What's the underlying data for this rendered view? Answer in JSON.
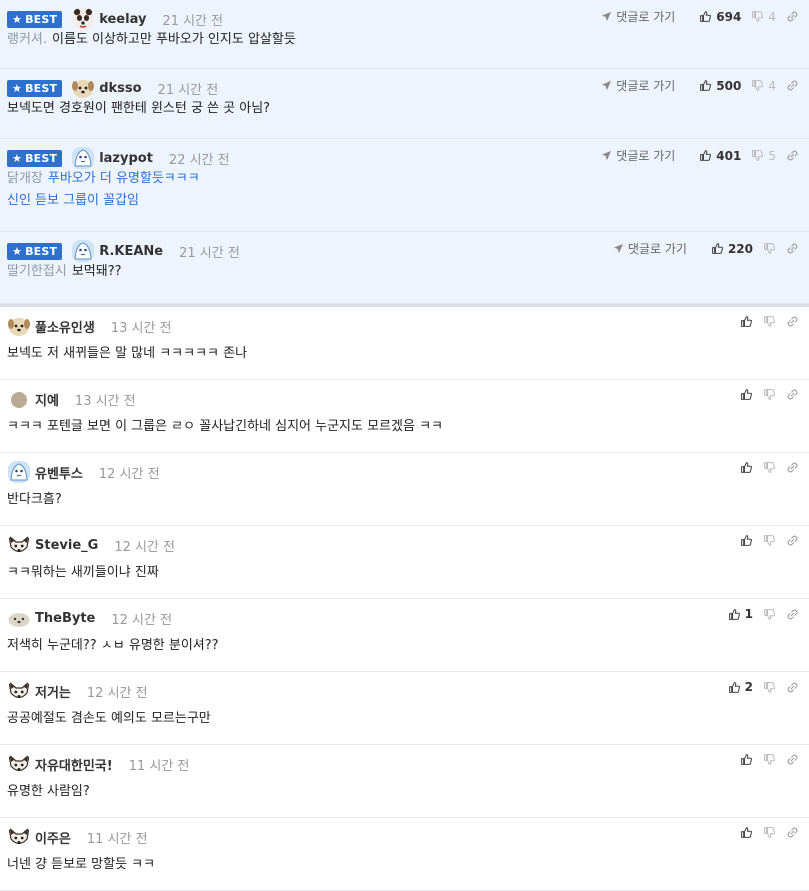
{
  "labels": {
    "best": "BEST",
    "goto": "댓글로 가기"
  },
  "best_comments": [
    {
      "nick": "keelay",
      "time": "21 시간 전",
      "lines": [
        {
          "prefix": "랭커셔.",
          "text": "이름도 이상하고만 푸바오가 인지도 압살할듯"
        }
      ],
      "up": "694",
      "down": "4",
      "avatar": "panda"
    },
    {
      "nick": "dksso",
      "time": "21 시간 전",
      "lines": [
        {
          "prefix": "",
          "text": "보넥도면 경호원이 팬한테 윈스턴 궁 쓴 곳 아님?"
        }
      ],
      "up": "500",
      "down": "4",
      "avatar": "dog"
    },
    {
      "nick": "lazypot",
      "time": "22 시간 전",
      "lines": [
        {
          "prefix": "닭개장",
          "text": "푸바오가 더 유명할듯ㅋㅋㅋ"
        },
        {
          "prefix": "",
          "text": "신인 듣보 그룹이 꼴갑임"
        }
      ],
      "up": "401",
      "down": "5",
      "avatar": "blue"
    },
    {
      "nick": "R.KEANe",
      "time": "21 시간 전",
      "lines": [
        {
          "prefix": "딸기한접시",
          "text": "보먹돼??"
        }
      ],
      "up": "220",
      "down": "",
      "avatar": "blue"
    }
  ],
  "comments": [
    {
      "nick": "풀소유인생",
      "time": "13 시간 전",
      "text": "보넥도 저 새뀌들은 말 많네 ㅋㅋㅋㅋㅋ 존나",
      "up": "",
      "down": "",
      "avatar": "dog"
    },
    {
      "nick": "지예",
      "time": "13 시간 전",
      "text": "ㅋㅋㅋ 포텐글 보면 이 그룹은 ㄹㅇ 꼴사납긴하네 심지어 누군지도 모르겠음 ㅋㅋ",
      "up": "",
      "down": "",
      "avatar": "grey"
    },
    {
      "nick": "유벤투스",
      "time": "12 시간 전",
      "text": "반다크흠?",
      "up": "",
      "down": "",
      "avatar": "blue"
    },
    {
      "nick": "Stevie_G",
      "time": "12 시간 전",
      "text": "ㅋㅋ뭐하는 새끼들이냐 진짜",
      "up": "",
      "down": "",
      "avatar": "fox"
    },
    {
      "nick": "TheByte",
      "time": "12 시간 전",
      "text": "저색히 누군데?? ㅅㅂ 유명한 분이셔??",
      "up": "1",
      "down": "",
      "avatar": "sheep"
    },
    {
      "nick": "저거는",
      "time": "12 시간 전",
      "text": "공공예절도 겸손도 예의도 모르는구만",
      "up": "2",
      "down": "",
      "avatar": "fox"
    },
    {
      "nick": "자유대한민국!",
      "time": "11 시간 전",
      "text": "유명한 사람임?",
      "up": "",
      "down": "",
      "avatar": "fox"
    },
    {
      "nick": "이주은",
      "time": "11 시간 전",
      "text": "너넨 걍 듣보로 망할듯 ㅋㅋ",
      "up": "",
      "down": "",
      "avatar": "fox"
    }
  ],
  "colors": {
    "best_bg": "#eef4fd",
    "badge": "#2f70cf",
    "link": "#2f70cf",
    "time": "#999999"
  }
}
